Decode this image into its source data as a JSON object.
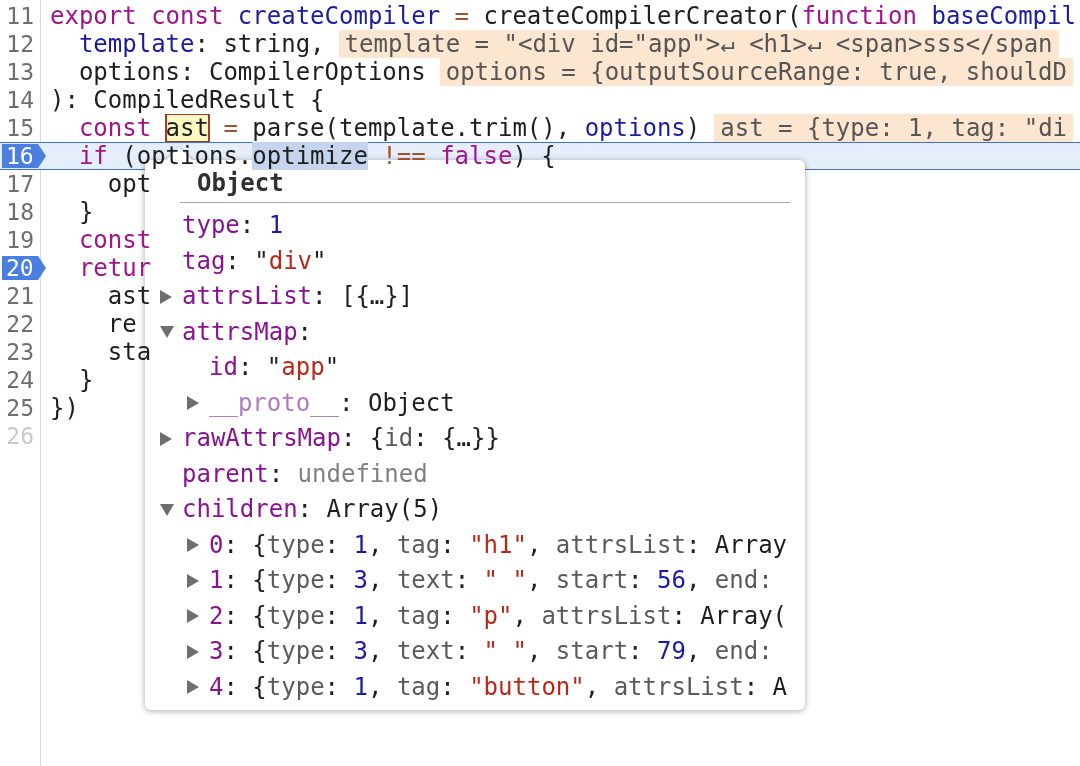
{
  "code_lines": [
    {
      "number": "11",
      "breakpoint": false,
      "current": false,
      "dimmed": false,
      "tokens": [
        {
          "kind": "keyword",
          "text": "export "
        },
        {
          "kind": "keyword",
          "text": "const "
        },
        {
          "kind": "definition",
          "text": "createCompiler "
        },
        {
          "kind": "operator",
          "text": "= "
        },
        {
          "kind": "plain",
          "text": "createCompilerCreator("
        },
        {
          "kind": "keyword",
          "text": "function "
        },
        {
          "kind": "definition",
          "text": "baseCompil"
        }
      ]
    },
    {
      "number": "12",
      "breakpoint": false,
      "current": false,
      "dimmed": false,
      "tokens": [
        {
          "kind": "definition",
          "text": "  template"
        },
        {
          "kind": "plain",
          "text": ": string,"
        }
      ],
      "hint": "template = \"<div id=\"app\">↵ <h1>↵ <span>sss</span"
    },
    {
      "number": "13",
      "breakpoint": false,
      "current": false,
      "dimmed": false,
      "tokens": [
        {
          "kind": "plain",
          "text": "  options: CompilerOptions"
        }
      ],
      "hint": "options = {outputSourceRange: true, shouldD"
    },
    {
      "number": "14",
      "breakpoint": false,
      "current": false,
      "dimmed": false,
      "tokens": [
        {
          "kind": "plain",
          "text": "): CompiledResult {"
        }
      ]
    },
    {
      "number": "15",
      "breakpoint": false,
      "current": false,
      "dimmed": false,
      "tokens": [
        {
          "kind": "keyword",
          "text": "  const "
        },
        {
          "kind": "hovered",
          "text": "ast"
        },
        {
          "kind": "operator",
          "text": " = "
        },
        {
          "kind": "plain",
          "text": "parse(template.trim(), "
        },
        {
          "kind": "definition",
          "text": "options"
        },
        {
          "kind": "plain",
          "text": ")"
        }
      ],
      "hint": "ast = {type: 1, tag: \"di"
    },
    {
      "number": "16",
      "breakpoint": true,
      "current": true,
      "dimmed": false,
      "tokens": [
        {
          "kind": "keyword",
          "text": "  if "
        },
        {
          "kind": "plain",
          "text": "(options."
        },
        {
          "kind": "selected",
          "text": "optimize"
        },
        {
          "kind": "operator",
          "text": " !== "
        },
        {
          "kind": "keyword",
          "text": "false"
        },
        {
          "kind": "plain",
          "text": ") {"
        }
      ]
    },
    {
      "number": "17",
      "breakpoint": false,
      "current": false,
      "dimmed": false,
      "tokens": [
        {
          "kind": "plain",
          "text": "    opt"
        }
      ]
    },
    {
      "number": "18",
      "breakpoint": false,
      "current": false,
      "dimmed": false,
      "tokens": [
        {
          "kind": "plain",
          "text": "  }"
        }
      ]
    },
    {
      "number": "19",
      "breakpoint": false,
      "current": false,
      "dimmed": false,
      "tokens": [
        {
          "kind": "keyword",
          "text": "  const"
        }
      ]
    },
    {
      "number": "20",
      "breakpoint": true,
      "current": false,
      "dimmed": false,
      "tokens": [
        {
          "kind": "keyword",
          "text": "  retur"
        }
      ]
    },
    {
      "number": "21",
      "breakpoint": false,
      "current": false,
      "dimmed": false,
      "tokens": [
        {
          "kind": "plain",
          "text": "    ast"
        }
      ]
    },
    {
      "number": "22",
      "breakpoint": false,
      "current": false,
      "dimmed": false,
      "tokens": [
        {
          "kind": "plain",
          "text": "    re"
        }
      ]
    },
    {
      "number": "23",
      "breakpoint": false,
      "current": false,
      "dimmed": false,
      "tokens": [
        {
          "kind": "plain",
          "text": "    sta"
        }
      ]
    },
    {
      "number": "24",
      "breakpoint": false,
      "current": false,
      "dimmed": false,
      "tokens": [
        {
          "kind": "plain",
          "text": "  }"
        }
      ]
    },
    {
      "number": "25",
      "breakpoint": false,
      "current": false,
      "dimmed": false,
      "tokens": [
        {
          "kind": "plain",
          "text": "})"
        }
      ]
    },
    {
      "number": "26",
      "breakpoint": false,
      "current": false,
      "dimmed": true
    }
  ],
  "popover": {
    "title": "Object",
    "properties": [
      {
        "kind": "leaf",
        "tokens": [
          {
            "kind": "key",
            "text": "type"
          },
          {
            "kind": "plain",
            "text": ": "
          },
          {
            "kind": "number",
            "text": "1"
          }
        ]
      },
      {
        "kind": "leaf",
        "tokens": [
          {
            "kind": "key",
            "text": "tag"
          },
          {
            "kind": "plain",
            "text": ": \""
          },
          {
            "kind": "string",
            "text": "div"
          },
          {
            "kind": "plain",
            "text": "\""
          }
        ]
      },
      {
        "kind": "branch",
        "expanded": false,
        "tokens": [
          {
            "kind": "key",
            "text": "attrsList"
          },
          {
            "kind": "plain",
            "text": ": [{…}]"
          }
        ]
      },
      {
        "kind": "branch",
        "expanded": true,
        "tokens": [
          {
            "kind": "key",
            "text": "attrsMap"
          },
          {
            "kind": "plain",
            "text": ":"
          }
        ],
        "children": [
          {
            "kind": "leaf",
            "tokens": [
              {
                "kind": "key",
                "text": "id"
              },
              {
                "kind": "plain",
                "text": ": \""
              },
              {
                "kind": "string",
                "text": "app"
              },
              {
                "kind": "plain",
                "text": "\""
              }
            ]
          },
          {
            "kind": "branch",
            "expanded": false,
            "tokens": [
              {
                "kind": "internal-key",
                "text": "__proto__"
              },
              {
                "kind": "plain",
                "text": ": Object"
              }
            ]
          }
        ]
      },
      {
        "kind": "branch",
        "expanded": false,
        "tokens": [
          {
            "kind": "key",
            "text": "rawAttrsMap"
          },
          {
            "kind": "plain",
            "text": ": {"
          },
          {
            "kind": "preview-key",
            "text": "id"
          },
          {
            "kind": "plain",
            "text": ": {…}}"
          }
        ]
      },
      {
        "kind": "leaf",
        "tokens": [
          {
            "kind": "key",
            "text": "parent"
          },
          {
            "kind": "plain",
            "text": ": "
          },
          {
            "kind": "undefined",
            "text": "undefined"
          }
        ]
      },
      {
        "kind": "branch",
        "expanded": true,
        "tokens": [
          {
            "kind": "key",
            "text": "children"
          },
          {
            "kind": "plain",
            "text": ": Array(5)"
          }
        ],
        "children": [
          {
            "kind": "branch",
            "expanded": false,
            "tokens": [
              {
                "kind": "key",
                "text": "0"
              },
              {
                "kind": "plain",
                "text": ": {"
              },
              {
                "kind": "preview-key",
                "text": "type"
              },
              {
                "kind": "plain",
                "text": ": "
              },
              {
                "kind": "number",
                "text": "1"
              },
              {
                "kind": "plain",
                "text": ", "
              },
              {
                "kind": "preview-key",
                "text": "tag"
              },
              {
                "kind": "plain",
                "text": ": "
              },
              {
                "kind": "string",
                "text": "\"h1\""
              },
              {
                "kind": "plain",
                "text": ", "
              },
              {
                "kind": "preview-key",
                "text": "attrsList"
              },
              {
                "kind": "plain",
                "text": ": Array"
              }
            ]
          },
          {
            "kind": "branch",
            "expanded": false,
            "tokens": [
              {
                "kind": "key",
                "text": "1"
              },
              {
                "kind": "plain",
                "text": ": {"
              },
              {
                "kind": "preview-key",
                "text": "type"
              },
              {
                "kind": "plain",
                "text": ": "
              },
              {
                "kind": "number",
                "text": "3"
              },
              {
                "kind": "plain",
                "text": ", "
              },
              {
                "kind": "preview-key",
                "text": "text"
              },
              {
                "kind": "plain",
                "text": ": "
              },
              {
                "kind": "string",
                "text": "\" \""
              },
              {
                "kind": "plain",
                "text": ", "
              },
              {
                "kind": "preview-key",
                "text": "start"
              },
              {
                "kind": "plain",
                "text": ": "
              },
              {
                "kind": "number",
                "text": "56"
              },
              {
                "kind": "plain",
                "text": ", "
              },
              {
                "kind": "preview-key",
                "text": "end:"
              }
            ]
          },
          {
            "kind": "branch",
            "expanded": false,
            "tokens": [
              {
                "kind": "key",
                "text": "2"
              },
              {
                "kind": "plain",
                "text": ": {"
              },
              {
                "kind": "preview-key",
                "text": "type"
              },
              {
                "kind": "plain",
                "text": ": "
              },
              {
                "kind": "number",
                "text": "1"
              },
              {
                "kind": "plain",
                "text": ", "
              },
              {
                "kind": "preview-key",
                "text": "tag"
              },
              {
                "kind": "plain",
                "text": ": "
              },
              {
                "kind": "string",
                "text": "\"p\""
              },
              {
                "kind": "plain",
                "text": ", "
              },
              {
                "kind": "preview-key",
                "text": "attrsList"
              },
              {
                "kind": "plain",
                "text": ": Array("
              }
            ]
          },
          {
            "kind": "branch",
            "expanded": false,
            "tokens": [
              {
                "kind": "key",
                "text": "3"
              },
              {
                "kind": "plain",
                "text": ": {"
              },
              {
                "kind": "preview-key",
                "text": "type"
              },
              {
                "kind": "plain",
                "text": ": "
              },
              {
                "kind": "number",
                "text": "3"
              },
              {
                "kind": "plain",
                "text": ", "
              },
              {
                "kind": "preview-key",
                "text": "text"
              },
              {
                "kind": "plain",
                "text": ": "
              },
              {
                "kind": "string",
                "text": "\" \""
              },
              {
                "kind": "plain",
                "text": ", "
              },
              {
                "kind": "preview-key",
                "text": "start"
              },
              {
                "kind": "plain",
                "text": ": "
              },
              {
                "kind": "number",
                "text": "79"
              },
              {
                "kind": "plain",
                "text": ", "
              },
              {
                "kind": "preview-key",
                "text": "end:"
              }
            ]
          },
          {
            "kind": "branch",
            "expanded": false,
            "tokens": [
              {
                "kind": "key",
                "text": "4"
              },
              {
                "kind": "plain",
                "text": ": {"
              },
              {
                "kind": "preview-key",
                "text": "type"
              },
              {
                "kind": "plain",
                "text": ": "
              },
              {
                "kind": "number",
                "text": "1"
              },
              {
                "kind": "plain",
                "text": ", "
              },
              {
                "kind": "preview-key",
                "text": "tag"
              },
              {
                "kind": "plain",
                "text": ": "
              },
              {
                "kind": "string",
                "text": "\"button\""
              },
              {
                "kind": "plain",
                "text": ", "
              },
              {
                "kind": "preview-key",
                "text": "attrsList"
              },
              {
                "kind": "plain",
                "text": ": A"
              }
            ]
          }
        ]
      }
    ]
  }
}
